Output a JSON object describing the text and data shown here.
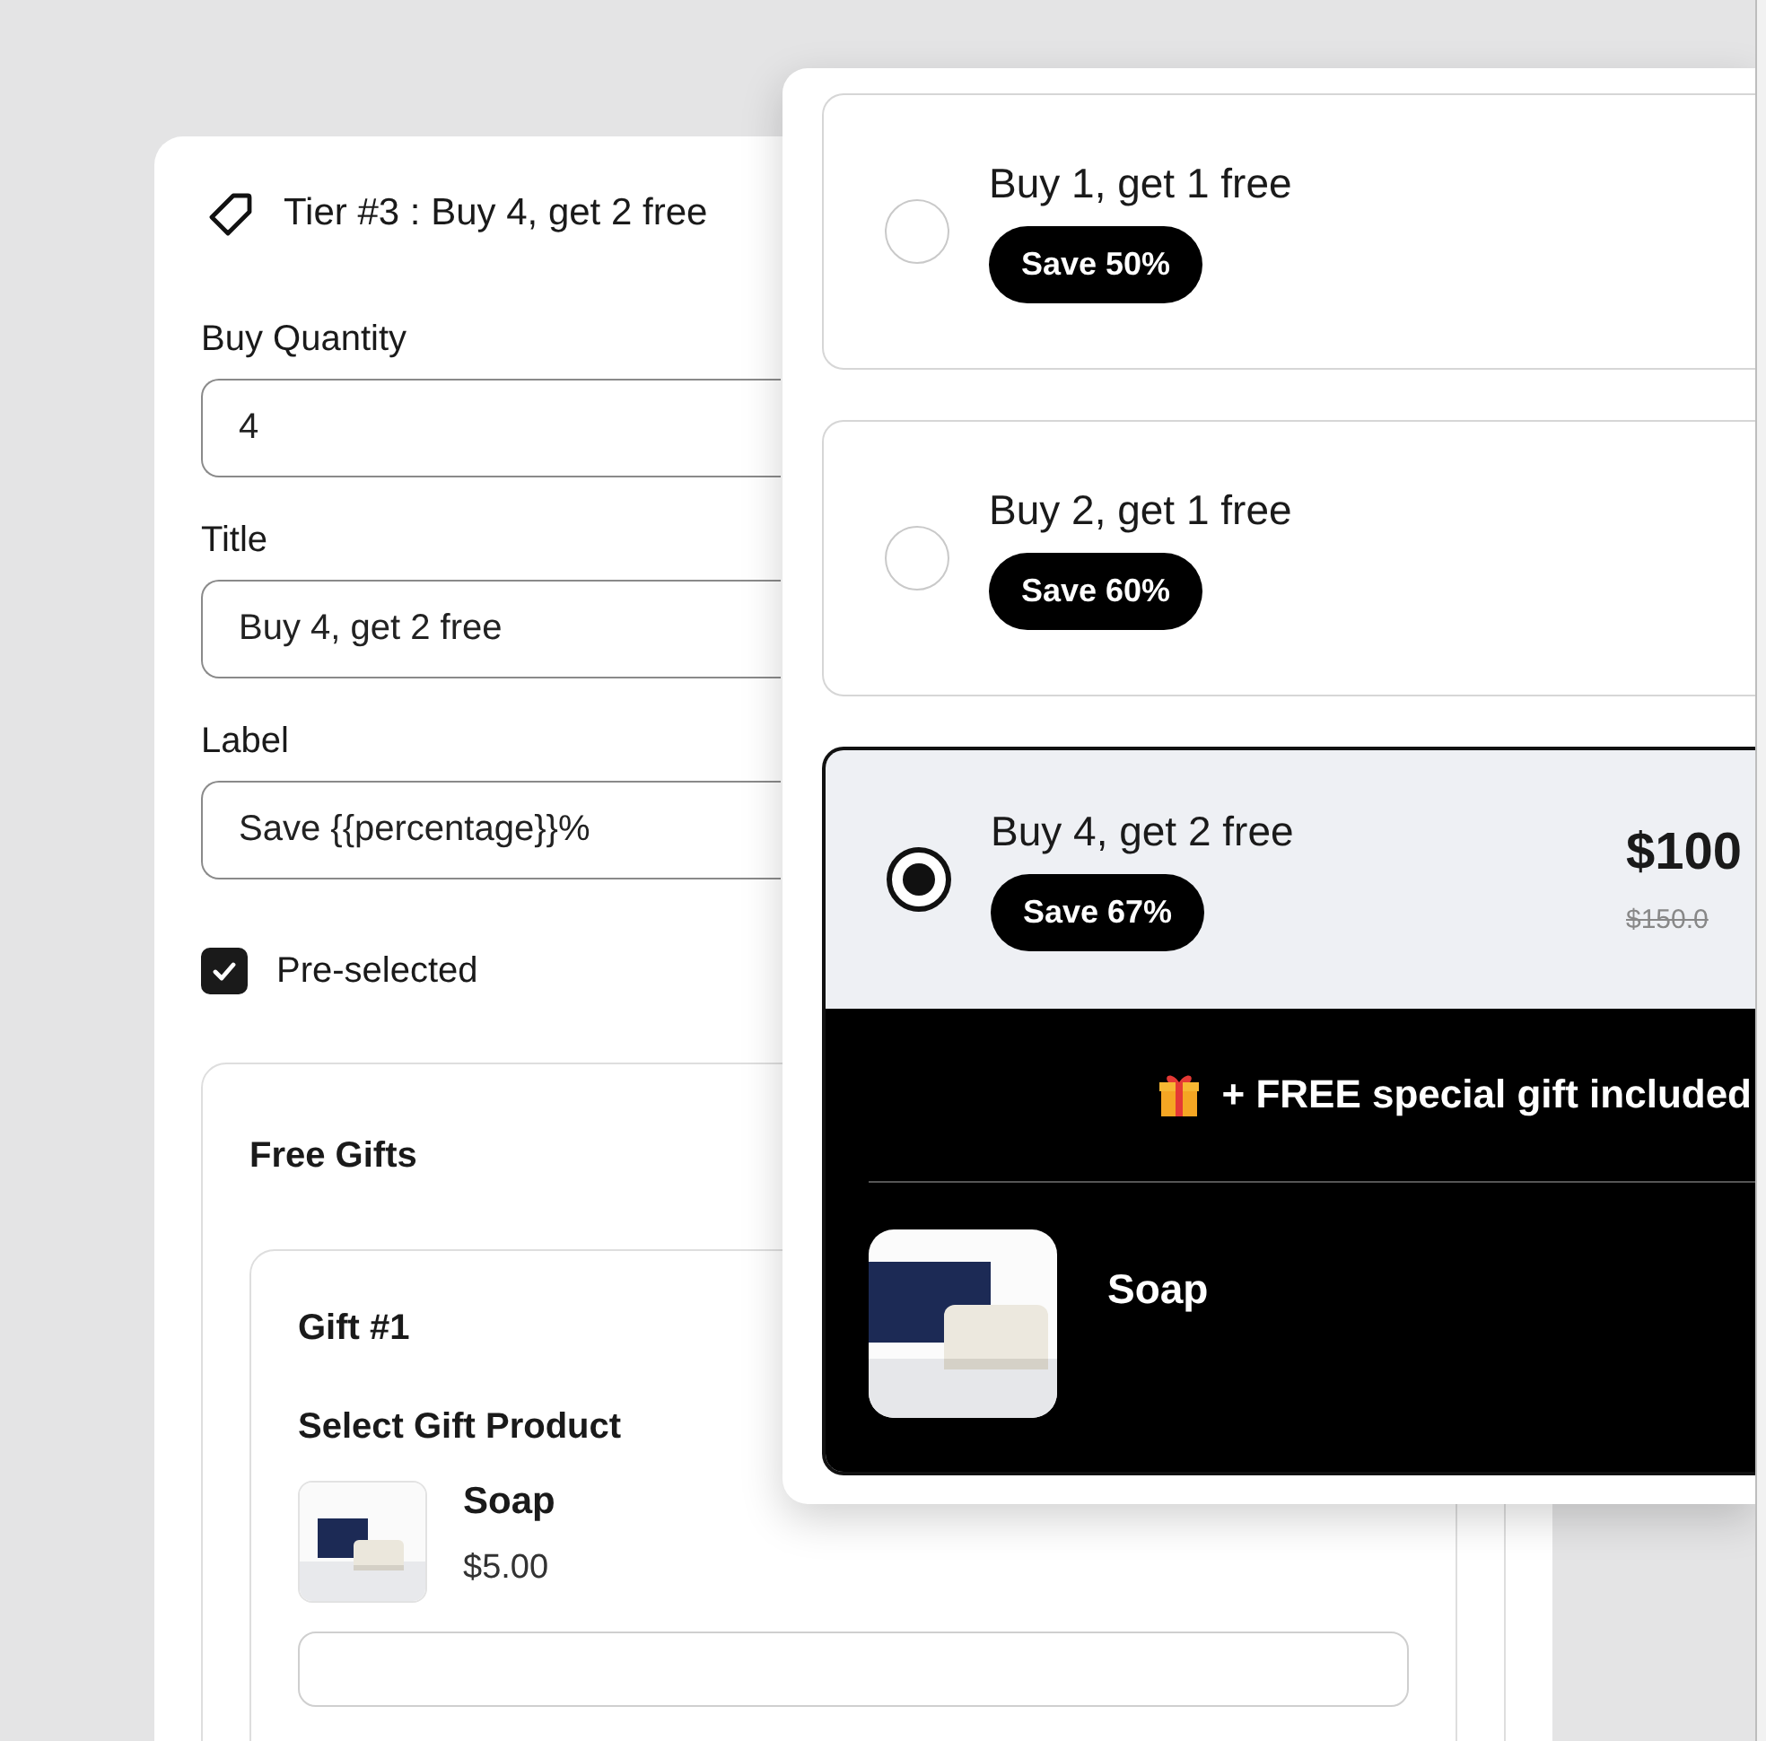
{
  "editor": {
    "heading": "Tier #3 : Buy 4, get 2 free",
    "fields": [
      {
        "label": "Buy Quantity",
        "value": "4"
      },
      {
        "label": "Title",
        "value": "Buy 4, get 2 free"
      },
      {
        "label": "Label",
        "value": "Save {{percentage}}%"
      }
    ],
    "preselected": {
      "label": "Pre-selected",
      "checked": true
    },
    "free_gifts": {
      "title": "Free Gifts",
      "gifts": [
        {
          "title": "Gift #1",
          "select_label": "Select Gift Product",
          "product": {
            "name": "Soap",
            "price": "$5.00"
          }
        }
      ]
    }
  },
  "preview": {
    "options": [
      {
        "title": "Buy 1, get 1 free",
        "badge": "Save 50%",
        "selected": false
      },
      {
        "title": "Buy 2, get 1 free",
        "badge": "Save 60%",
        "selected": false
      },
      {
        "title": "Buy 4, get 2 free",
        "badge": "Save 67%",
        "selected": true,
        "price": "$100",
        "compare_price": "$150.0",
        "gift_banner": "+ FREE special gift included",
        "gift_product": {
          "name": "Soap"
        }
      }
    ]
  }
}
